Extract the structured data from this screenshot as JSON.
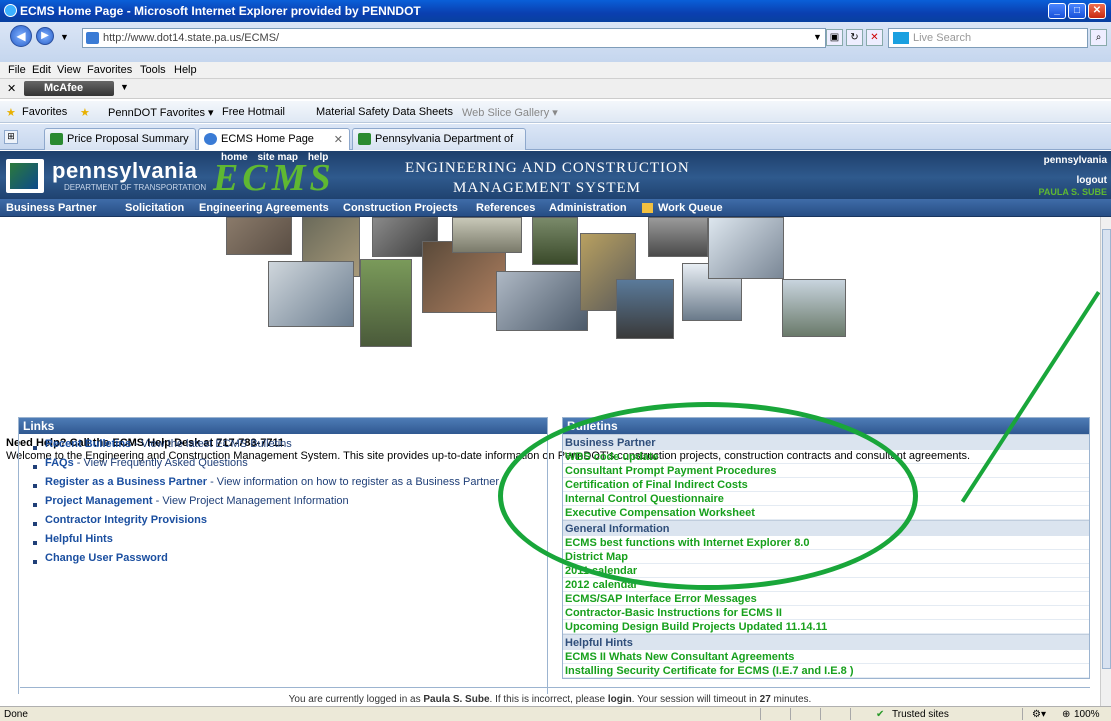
{
  "window": {
    "title": "ECMS Home Page - Microsoft Internet Explorer provided by PENNDOT"
  },
  "address": {
    "url": "http://www.dot14.state.pa.us/ECMS/",
    "search_placeholder": "Live Search"
  },
  "menu": [
    "File",
    "Edit",
    "View",
    "Favorites",
    "Tools",
    "Help"
  ],
  "mcafee": {
    "label": "McAfee"
  },
  "favorites": {
    "label": "Favorites",
    "items": [
      "PennDOT Favorites ▾",
      "Free Hotmail",
      "Material Safety Data Sheets",
      "Web Slice Gallery ▾"
    ]
  },
  "tabs": [
    {
      "label": "Price Proposal Summary"
    },
    {
      "label": "ECMS Home Page"
    },
    {
      "label": "Pennsylvania Department of ..."
    }
  ],
  "header": {
    "state": "pennsylvania",
    "dept": "DEPARTMENT OF TRANSPORTATION",
    "links": [
      "home",
      "site map",
      "help"
    ],
    "ecms": "ECMS",
    "title_line1": "ENGINEERING AND CONSTRUCTION",
    "title_line2": "MANAGEMENT SYSTEM",
    "top_right": "pennsylvania",
    "logout": "logout",
    "user": "PAULA S. SUBE"
  },
  "nav": [
    "Business Partner",
    "Solicitation",
    "Engineering Agreements",
    "Construction Projects",
    "References",
    "Administration",
    "Work Queue"
  ],
  "help_text": "Need Help? Call the ECMS Help Desk at 717-783-7711",
  "welcome_text": "Welcome to the Engineering and Construction Management System. This site provides up-to-date information on PennDOT's construction projects, construction contracts and consultant agreements.",
  "links_panel": {
    "title": "Links",
    "items": [
      {
        "label": "Recent Bulletins",
        "desc": " - View the latest ECMS Bulletins"
      },
      {
        "label": "FAQs",
        "desc": " - View Frequently Asked Questions"
      },
      {
        "label": "Register as a Business Partner",
        "desc": " - View information on how to register as a Business Partner"
      },
      {
        "label": "Project Management",
        "desc": " - View Project Management Information"
      },
      {
        "label": "Contractor Integrity Provisions",
        "desc": ""
      },
      {
        "label": "Helpful Hints",
        "desc": ""
      },
      {
        "label": "Change User Password",
        "desc": ""
      }
    ]
  },
  "bulletins": {
    "title": "Bulletins",
    "sections": [
      {
        "name": "Business Partner",
        "items": [
          "WBS code update",
          "Consultant Prompt Payment Procedures",
          "Certification of Final Indirect Costs",
          "Internal Control Questionnaire",
          "Executive Compensation Worksheet"
        ]
      },
      {
        "name": "General Information",
        "items": [
          "ECMS best functions with Internet Explorer 8.0",
          "District Map",
          "2011 calendar",
          "2012 calendar",
          "ECMS/SAP Interface Error Messages",
          "Contractor-Basic Instructions for ECMS II",
          "Upcoming Design Build Projects Updated 11.14.11"
        ]
      },
      {
        "name": "Helpful Hints",
        "items": [
          "ECMS II Whats New Consultant Agreements",
          "Installing Security Certificate for ECMS (I.E.7 and I.E.8 )"
        ]
      }
    ]
  },
  "footer": {
    "pre": "You are currently logged in as ",
    "user": "Paula S. Sube",
    "mid": ". If this is incorrect, please ",
    "login": "login",
    "post": ". Your session will timeout in ",
    "minutes": "27",
    "end": " minutes."
  },
  "status": {
    "left": "Done",
    "zone": "Trusted sites",
    "zoom": "100%"
  },
  "colors": {
    "accent_green": "#19a63a",
    "header_blue": "#2f5a8d",
    "bulletin_green": "#17a01c"
  }
}
